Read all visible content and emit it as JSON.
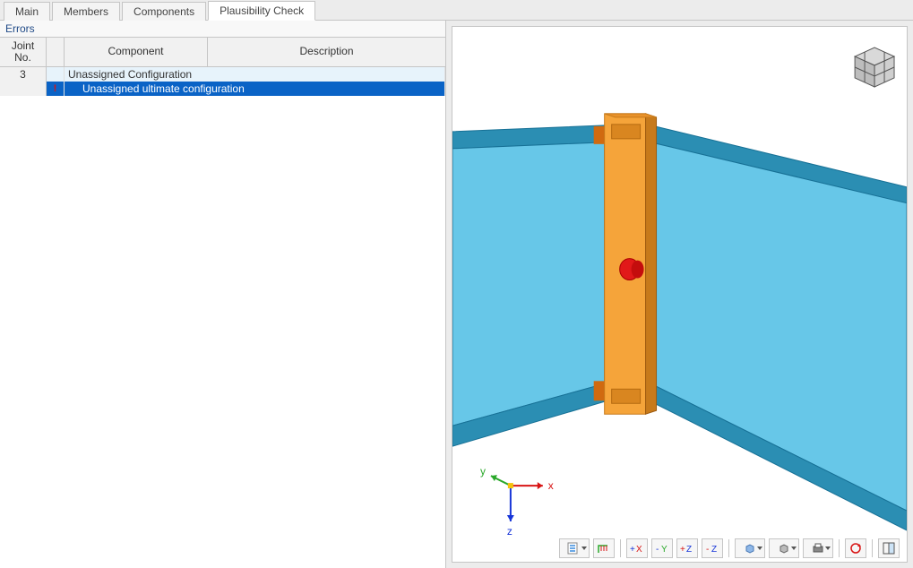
{
  "tabs": {
    "items": [
      "Main",
      "Members",
      "Components",
      "Plausibility Check"
    ],
    "active_index": 3
  },
  "left": {
    "errors_label": "Errors",
    "columns": {
      "joint_no": "Joint\nNo.",
      "component": "Component",
      "description": "Description"
    },
    "rows": [
      {
        "type": "group",
        "joint_no": "3",
        "text": "Unassigned Configuration"
      },
      {
        "type": "item",
        "joint_no": "",
        "icon": "warning",
        "text": "Unassigned ultimate configuration",
        "selected": true
      }
    ]
  },
  "viewport": {
    "axes": {
      "x": "x",
      "y": "y",
      "z": "z"
    },
    "nav_cube": "iso-cube",
    "colors": {
      "beam_face": "#67c7e8",
      "beam_top": "#2b8eb3",
      "beam_edge": "#177196",
      "plate_face": "#f5a43a",
      "plate_side": "#c77a1b",
      "bolt": "#e11919"
    }
  },
  "toolbar": {
    "buttons": [
      {
        "name": "display-settings",
        "dd": true
      },
      {
        "name": "show-loads",
        "dd": false
      },
      {
        "sep": true
      },
      {
        "name": "view-plus-x",
        "dd": false
      },
      {
        "name": "view-minus-y",
        "dd": false
      },
      {
        "name": "view-plus-z",
        "dd": false
      },
      {
        "name": "view-minus-z",
        "dd": false
      },
      {
        "sep": true
      },
      {
        "name": "view-isometric",
        "dd": true
      },
      {
        "name": "render-mode",
        "dd": true
      },
      {
        "name": "print-view",
        "dd": true
      },
      {
        "sep": true
      },
      {
        "name": "reset-view",
        "dd": false
      },
      {
        "sep": true
      },
      {
        "name": "fullscreen",
        "dd": false
      }
    ],
    "axis_labels": {
      "px": "+X",
      "my": "-Y",
      "pz": "+Z",
      "mz": "-Z"
    }
  }
}
